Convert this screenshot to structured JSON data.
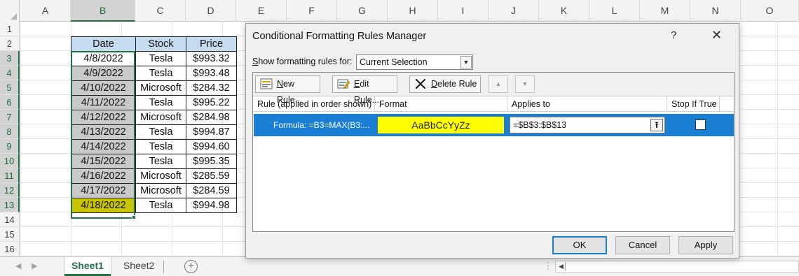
{
  "spreadsheet": {
    "columns": [
      "A",
      "B",
      "C",
      "D",
      "E",
      "F",
      "G",
      "H",
      "I",
      "J",
      "K",
      "L",
      "M",
      "N",
      "O"
    ],
    "rows": [
      "1",
      "2",
      "3",
      "4",
      "5",
      "6",
      "7",
      "8",
      "9",
      "10",
      "11",
      "12",
      "13",
      "14",
      "15",
      "16"
    ],
    "table_headers": {
      "date": "Date",
      "stock": "Stock",
      "price": "Price"
    },
    "table_rows": [
      {
        "date": "4/8/2022",
        "stock": "Tesla",
        "price": "$993.32"
      },
      {
        "date": "4/9/2022",
        "stock": "Tesla",
        "price": "$993.48"
      },
      {
        "date": "4/10/2022",
        "stock": "Microsoft",
        "price": "$284.32"
      },
      {
        "date": "4/11/2022",
        "stock": "Tesla",
        "price": "$995.22"
      },
      {
        "date": "4/12/2022",
        "stock": "Microsoft",
        "price": "$284.98"
      },
      {
        "date": "4/13/2022",
        "stock": "Tesla",
        "price": "$994.87"
      },
      {
        "date": "4/14/2022",
        "stock": "Tesla",
        "price": "$994.60"
      },
      {
        "date": "4/15/2022",
        "stock": "Tesla",
        "price": "$995.35"
      },
      {
        "date": "4/16/2022",
        "stock": "Microsoft",
        "price": "$285.59"
      },
      {
        "date": "4/17/2022",
        "stock": "Microsoft",
        "price": "$284.59"
      },
      {
        "date": "4/18/2022",
        "stock": "Tesla",
        "price": "$994.98"
      }
    ],
    "colors": {
      "header_fill": "#c5dcf0",
      "selected_fill": "#c9c9c9",
      "highlight_fill": "#c8c400",
      "selection_border": "#217346"
    }
  },
  "sheet_tabs": [
    "Sheet1",
    "Sheet2"
  ],
  "icons": {
    "add_sheet": "plus-circle-icon",
    "new_rule": "new-rule-icon",
    "edit_rule": "edit-rule-icon",
    "delete_rule": "x-delete-icon",
    "move_up": "triangle-up-icon",
    "move_down": "triangle-down-icon",
    "collapse": "collapse-dialog-icon"
  },
  "dialog": {
    "title": "Conditional Formatting Rules Manager",
    "help": "?",
    "close": "✕",
    "show_rules_label_first": "S",
    "show_rules_label_rest": "how formatting rules for:",
    "show_rules_value": "Current Selection",
    "toolbar": {
      "new_rule_u": "N",
      "new_rule_rest": "ew Rule...",
      "edit_rule_u": "E",
      "edit_rule_rest": "dit Rule...",
      "delete_rule_u": "D",
      "delete_rule_rest": "elete Rule"
    },
    "columns": {
      "rule": "Rule (applied in order shown)",
      "format": "Format",
      "applies_to": "Applies to",
      "stop_if_true": "Stop If True"
    },
    "rule": {
      "name": "Formula: =B3=MAX(B3:...",
      "format_preview": "AaBbCcYyZz",
      "applies_to": "=$B$3:$B$13",
      "stop_if_true": false
    },
    "colors": {
      "selected_row": "#1a7ed4",
      "format_fill": "#ffff00"
    },
    "buttons": {
      "ok": "OK",
      "cancel": "Cancel",
      "apply": "Apply"
    }
  }
}
